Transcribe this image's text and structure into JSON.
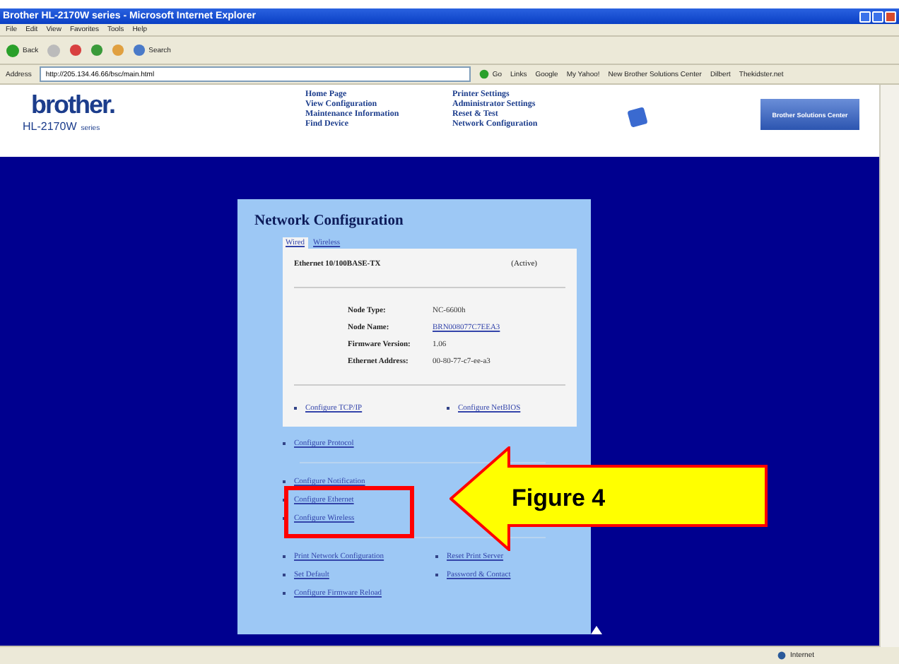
{
  "window": {
    "title": "Brother HL-2170W series - Microsoft Internet Explorer"
  },
  "menu": [
    "File",
    "Edit",
    "View",
    "Favorites",
    "Tools",
    "Help"
  ],
  "toolbar": {
    "back": "Back",
    "search": "Search"
  },
  "address": {
    "label": "Address",
    "url": "http://205.134.46.66/bsc/main.html",
    "go": "Go",
    "links_label": "Links",
    "links": [
      "Google",
      "My Yahoo!",
      "New Brother Solutions Center",
      "Dilbert",
      "Thekidster.net"
    ]
  },
  "header": {
    "logo": "brother.",
    "model": "HL-2170W",
    "series": "series",
    "nav_left": [
      "Home Page",
      "View Configuration",
      "Maintenance Information",
      "Find Device"
    ],
    "nav_right": [
      "Printer Settings",
      "Administrator Settings",
      "Reset & Test",
      "Network Configuration"
    ],
    "solutions": "Brother Solutions Center"
  },
  "panel": {
    "title": "Network Configuration",
    "tabs": [
      {
        "label": "Wired",
        "selected": true
      },
      {
        "label": "Wireless",
        "selected": false
      }
    ],
    "interface": "Ethernet 10/100BASE-TX",
    "status": "(Active)",
    "info": [
      {
        "label": "Node Type:",
        "value": "NC-6600h",
        "link": false
      },
      {
        "label": "Node Name:",
        "value": "BRN008077C7EEA3",
        "link": true
      },
      {
        "label": "Firmware Version:",
        "value": "1.06",
        "link": false
      },
      {
        "label": "Ethernet Address:",
        "value": "00-80-77-c7-ee-a3",
        "link": false
      }
    ],
    "card_links": [
      [
        "Configure TCP/IP"
      ],
      [
        "Configure NetBIOS"
      ]
    ],
    "protocol": "Configure Protocol",
    "middle_links": [
      "Configure Notification",
      "Configure Ethernet",
      "Configure Wireless"
    ],
    "bottom_left": [
      "Print Network Configuration",
      "Set Default",
      "Configure Firmware Reload"
    ],
    "bottom_right": [
      "Reset Print Server",
      "Password & Contact"
    ]
  },
  "annotation": {
    "label": "Figure 4"
  },
  "status_bar": {
    "zone": "Internet"
  }
}
